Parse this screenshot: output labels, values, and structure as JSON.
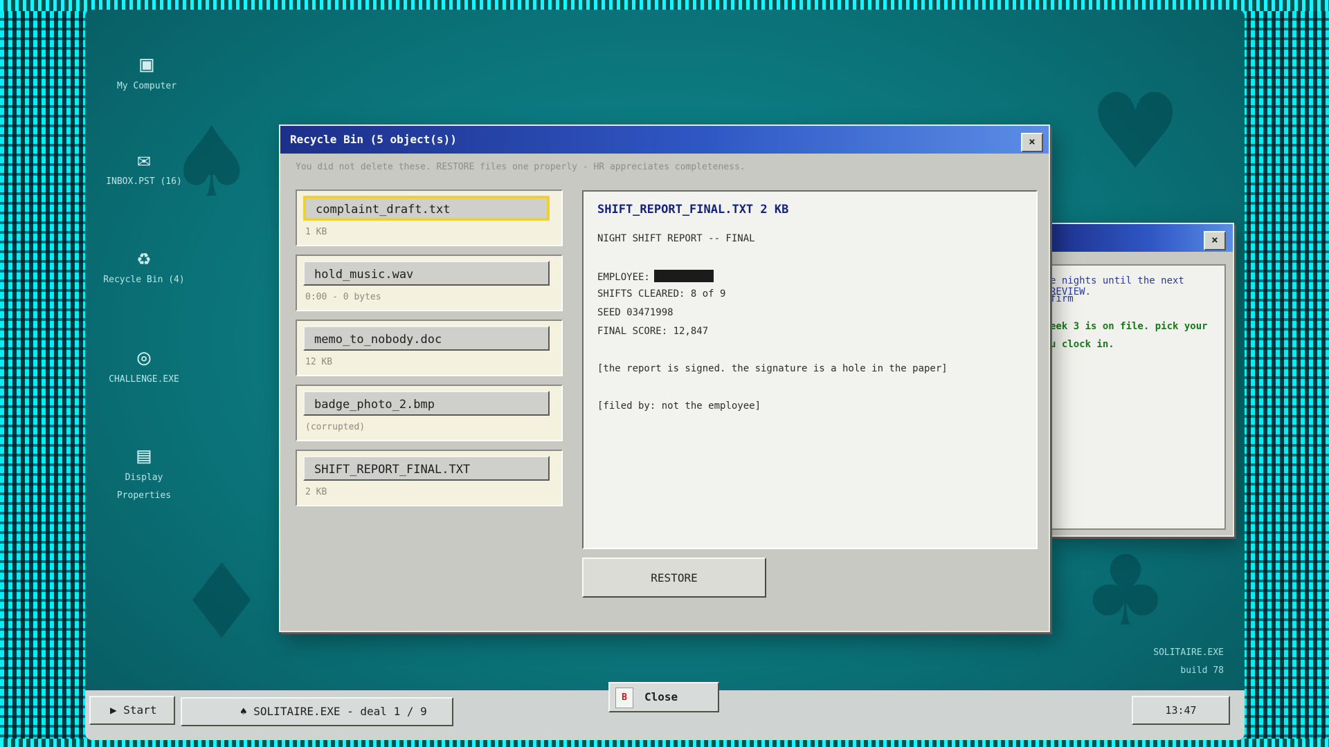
{
  "desktop_icons": [
    {
      "label": "My Computer",
      "icon": "computer-icon"
    },
    {
      "label": "INBOX.PST  (16)",
      "icon": "mail-icon"
    },
    {
      "label": "Recycle Bin  (4)",
      "icon": "recycle-icon"
    },
    {
      "label": "CHALLENGE.EXE",
      "icon": "target-icon"
    },
    {
      "label_line1": "Display",
      "label_line2": "Properties",
      "icon": "display-properties-icon"
    }
  ],
  "recycle_window": {
    "title": "Recycle Bin  (5 object(s))",
    "close_glyph": "×",
    "hint": "You did not delete these. RESTORE files one properly - HR appreciates completeness.",
    "files": [
      {
        "name": "complaint_draft.txt",
        "meta": "1 KB",
        "selected": true
      },
      {
        "name": "hold_music.wav",
        "meta": "0:00 - 0 bytes",
        "selected": false
      },
      {
        "name": "memo_to_nobody.doc",
        "meta": "12 KB",
        "selected": false
      },
      {
        "name": "badge_photo_2.bmp",
        "meta": "(corrupted)",
        "selected": false
      },
      {
        "name": "SHIFT_REPORT_FINAL.TXT",
        "meta": "2 KB",
        "selected": false
      }
    ],
    "preview": {
      "title": "SHIFT_REPORT_FINAL.TXT  2 KB",
      "heading": "NIGHT SHIFT REPORT -- FINAL",
      "employee_label": "EMPLOYEE:",
      "shifts": "SHIFTS CLEARED: 8 of 9",
      "seed": "SEED 03471998",
      "score": "FINAL SCORE: 12,847",
      "note1": "[the report is signed. the signature is a hole in the paper]",
      "note2": "[filed by: not the employee]"
    },
    "restore_label": "RESTORE"
  },
  "back_window": {
    "close_glyph": "×",
    "line1": "e nights until the next REVIEW.",
    "line2": "firm",
    "line3": "eek 3 is on file. pick your",
    "line4": "u clock in."
  },
  "suits": {
    "spade": "♠",
    "heart": "♥",
    "diamond": "♦",
    "club": "♣"
  },
  "corner": {
    "app": "SOLITAIRE.EXE",
    "build": "build 78"
  },
  "taskbar": {
    "start_icon": "▶",
    "start_label": "Start",
    "task_icon": "♠",
    "task_label": "SOLITAIRE.EXE - deal 1 / 9",
    "close_key": "B",
    "close_label": "Close",
    "clock": "13:47"
  },
  "colors": {
    "accent_title": "#1d2f8a",
    "selection": "#ecd22c",
    "frame": "#19f2ff",
    "green_text": "#167a16",
    "link_text": "#2a3a9a"
  }
}
